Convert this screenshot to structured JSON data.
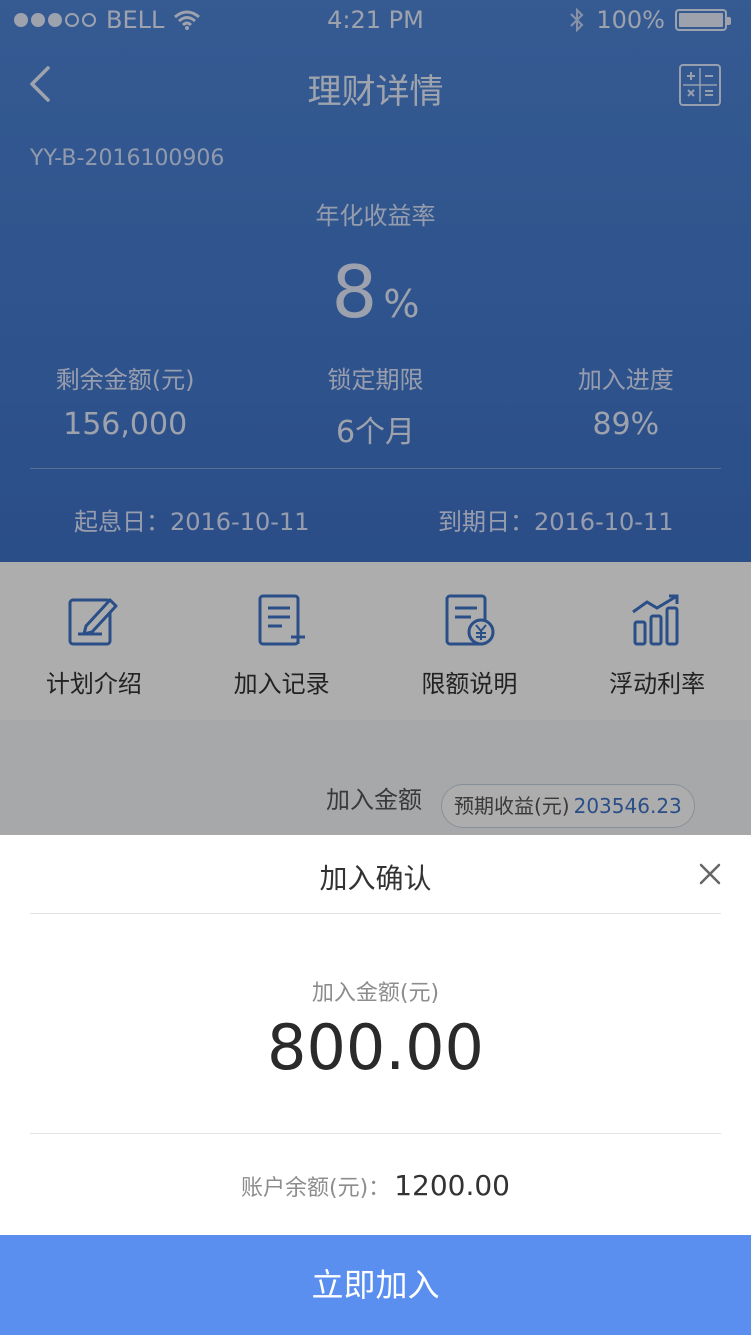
{
  "status_bar": {
    "carrier": "BELL",
    "time": "4:21 PM",
    "battery": "100%"
  },
  "nav": {
    "title": "理财详情"
  },
  "product": {
    "code": "YY-B-2016100906",
    "rate_label": "年化收益率",
    "rate_value": "8",
    "rate_unit": "%",
    "stats": [
      {
        "label": "剩余金额(元)",
        "value": "156,000"
      },
      {
        "label": "锁定期限",
        "value": "6个月"
      },
      {
        "label": "加入进度",
        "value": "89%"
      }
    ],
    "start_date_label": "起息日：",
    "start_date": "2016-10-11",
    "end_date_label": "到期日：",
    "end_date": "2016-10-11"
  },
  "menu": [
    {
      "label": "计划介绍",
      "icon": "edit-icon"
    },
    {
      "label": "加入记录",
      "icon": "record-add-icon"
    },
    {
      "label": "限额说明",
      "icon": "limit-yuan-icon"
    },
    {
      "label": "浮动利率",
      "icon": "trend-chart-icon"
    }
  ],
  "form": {
    "join_amount_label": "加入金额",
    "expected_income_label": "预期收益(元)",
    "expected_income_value": "203546.23"
  },
  "sheet": {
    "title": "加入确认",
    "amount_label": "加入金额(元)",
    "amount_value": "800.00",
    "balance_label": "账户余额(元)：",
    "balance_value": "1200.00",
    "confirm_label": "立即加入"
  },
  "colors": {
    "primary": "#3f73c9",
    "button": "#5a8ff0"
  }
}
